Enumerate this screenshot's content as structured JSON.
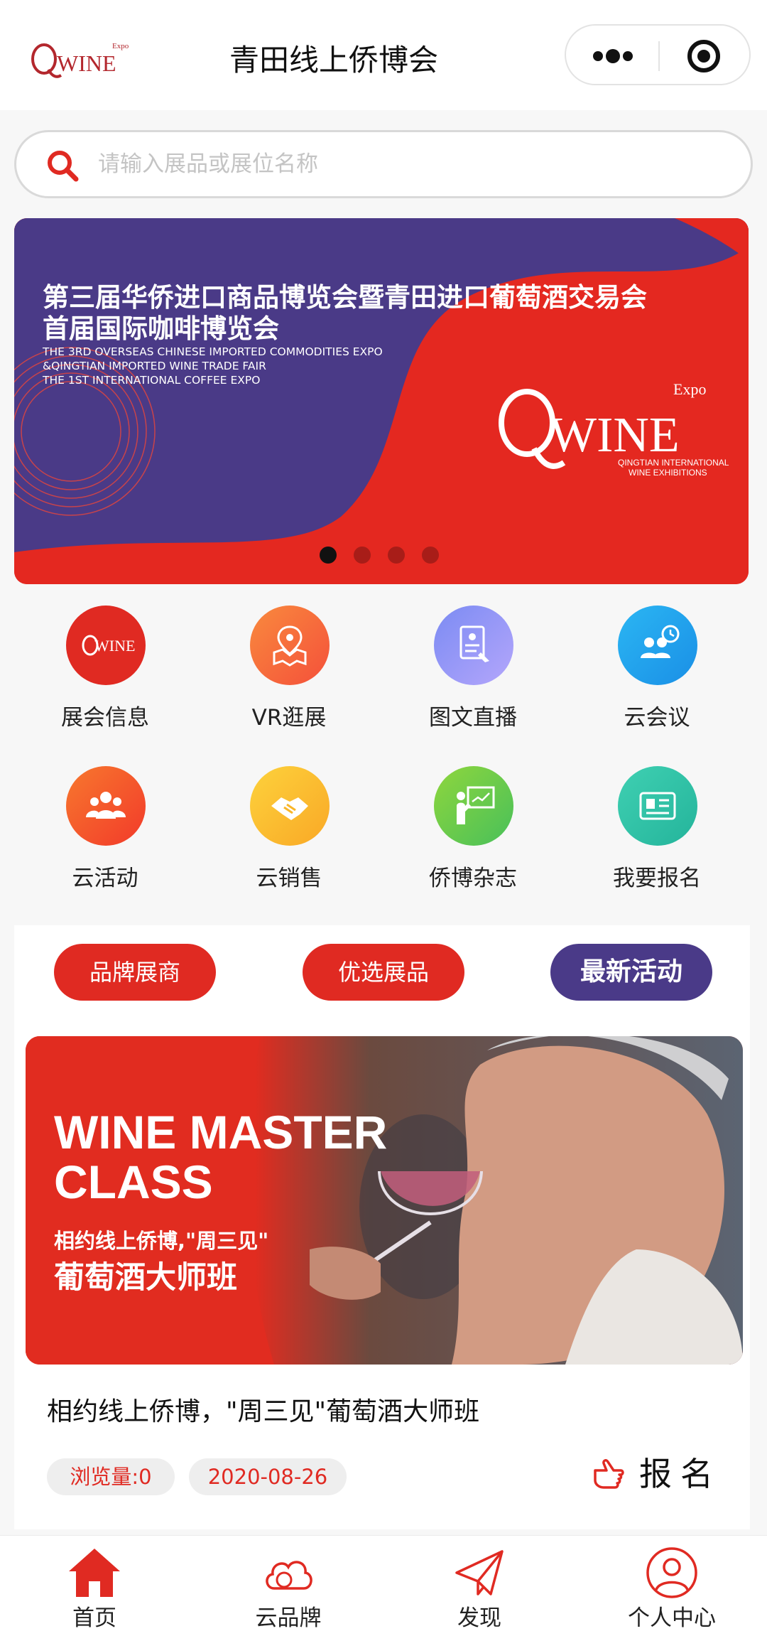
{
  "header": {
    "title": "青田线上侨博会",
    "logo_text": "WINE",
    "logo_expo": "Expo"
  },
  "search": {
    "placeholder": "请输入展品或展位名称",
    "value": ""
  },
  "banner": {
    "title_line1": "第三届华侨进口商品博览会暨青田进口葡萄酒交易会",
    "title_line2": "首届国际咖啡博览会",
    "en_line1": "THE 3RD OVERSEAS CHINESE IMPORTED COMMODITIES EXPO",
    "en_line2": "&QINGTIAN IMPORTED WINE TRADE FAIR",
    "en_line3": "THE 1ST INTERNATIONAL COFFEE EXPO",
    "brand_text": "WINE",
    "brand_expo": "Expo",
    "brand_sub1": "QINGTIAN INTERNATIONAL",
    "brand_sub2": "WINE EXHIBITIONS",
    "slides_total": 4,
    "active_slide": 1
  },
  "menu": [
    {
      "label": "展会信息",
      "icon": "qwine-logo-icon",
      "color": "#e02a22"
    },
    {
      "label": "VR逛展",
      "icon": "map-pin-icon",
      "color": "#f76a36"
    },
    {
      "label": "图文直播",
      "icon": "document-edit-icon",
      "color": "#8f9bf5"
    },
    {
      "label": "云会议",
      "icon": "meeting-clock-icon",
      "color": "#1aa7ef"
    },
    {
      "label": "云活动",
      "icon": "people-group-icon",
      "color": "#f5542f"
    },
    {
      "label": "云销售",
      "icon": "handshake-icon",
      "color": "#fbc32f"
    },
    {
      "label": "侨博杂志",
      "icon": "presentation-icon",
      "color": "#6fcf4a"
    },
    {
      "label": "我要报名",
      "icon": "id-card-icon",
      "color": "#33c4a6"
    }
  ],
  "tabs": [
    {
      "label": "品牌展商",
      "active": false
    },
    {
      "label": "优选展品",
      "active": false
    },
    {
      "label": "最新活动",
      "active": true
    }
  ],
  "article": {
    "image_headline1": "WINE MASTER",
    "image_headline2": "CLASS",
    "image_sub": "相约线上侨博,\"周三见\"",
    "image_cn": "葡萄酒大师班",
    "title": "相约线上侨博，\"周三见\"葡萄酒大师班",
    "views": "浏览量:0",
    "date": "2020-08-26",
    "signup_label": "报名"
  },
  "bottom_nav": [
    {
      "label": "首页",
      "icon": "home-icon",
      "active": true
    },
    {
      "label": "云品牌",
      "icon": "cloud-icon",
      "active": false
    },
    {
      "label": "发现",
      "icon": "paper-plane-icon",
      "active": false
    },
    {
      "label": "个人中心",
      "icon": "user-icon",
      "active": false
    }
  ],
  "colors": {
    "brand_red": "#e02a22",
    "brand_purple": "#4a3a88",
    "banner_purple": "#4a3a87"
  }
}
